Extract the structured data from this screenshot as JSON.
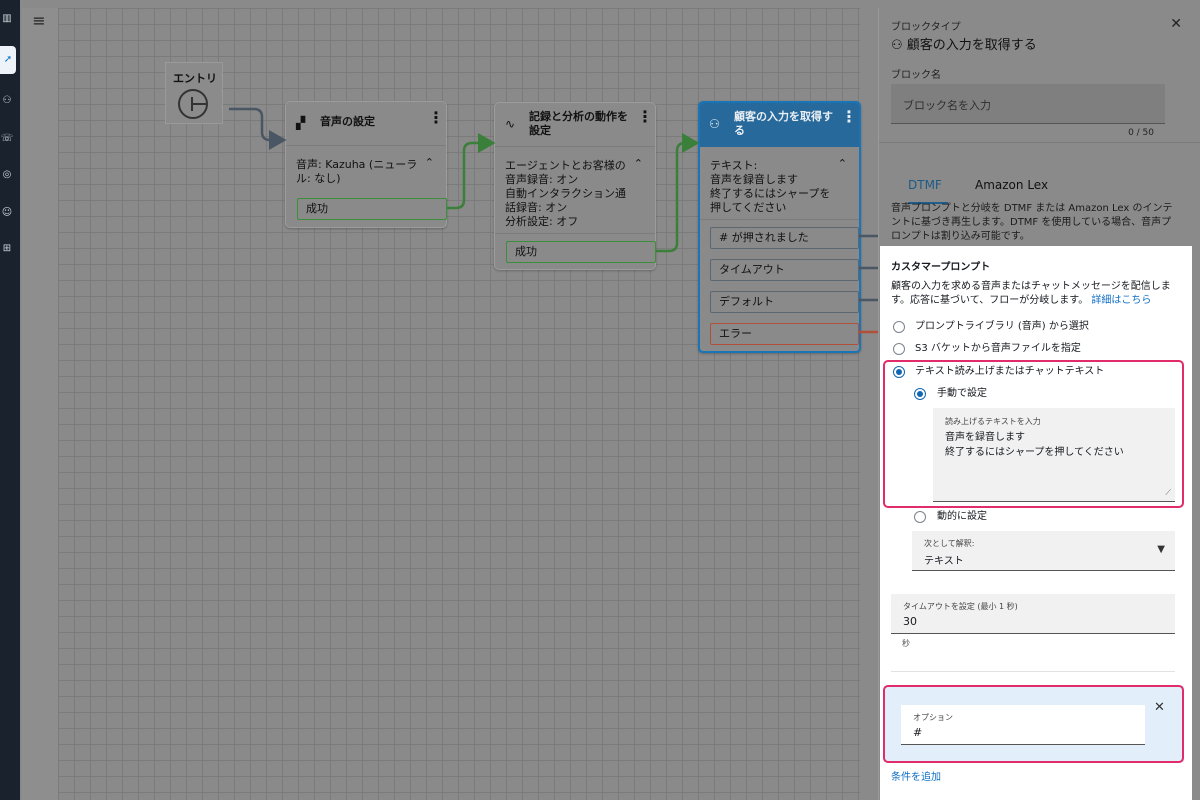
{
  "nav": {
    "icons": [
      "bar-chart-icon",
      "routing-icon",
      "users-icon",
      "phone-flow-icon",
      "headset-icon",
      "person-icon",
      "hierarchy-icon"
    ]
  },
  "canvas": {
    "menu_glyph": "≡",
    "entry": {
      "title": "エントリ"
    },
    "blocks": [
      {
        "title": "音声の設定",
        "body": "音声: Kazuha (ニューラル: なし)",
        "ports": [
          "成功"
        ]
      },
      {
        "title": "記録と分析の動作を設定",
        "body": "エージェントとお客様の音声録音: オン\n自動インタラクション通話録音: オン\n分析設定: オフ",
        "ports": [
          "成功"
        ]
      },
      {
        "title": "顧客の入力を取得する",
        "body": "テキスト:\n音声を録音します\n終了するにはシャープを押してください",
        "ports": [
          "# が押されました",
          "タイムアウト",
          "デフォルト",
          "エラー"
        ]
      }
    ]
  },
  "panel": {
    "block_type_label": "ブロックタイプ",
    "block_type": "顧客の入力を取得する",
    "block_name_label": "ブロック名",
    "block_name_placeholder": "ブロック名を入力",
    "counter": "0 / 50",
    "tabs": [
      "DTMF",
      "Amazon Lex"
    ],
    "description": "音声プロンプトと分岐を DTMF または Amazon Lex のインテントに基づき再生します。DTMF を使用している場合、音声プロンプトは割り込み可能です。",
    "prompt": {
      "heading": "カスタマープロンプト",
      "description": "顧客の入力を求める音声またはチャットメッセージを配信します。応答に基づいて、フローが分岐します。",
      "link": "詳細はこちら",
      "options": [
        "プロンプトライブラリ (音声) から選択",
        "S3 バケットから音声ファイルを指定",
        "テキスト読み上げまたはチャットテキスト"
      ],
      "sub_options": [
        "手動で設定",
        "動的に設定"
      ],
      "text_label": "読み上げるテキストを入力",
      "text_value": "音声を録音します\n終了するにはシャープを押してください",
      "interpret_label": "次として解釈:",
      "interpret_value": "テキスト"
    },
    "timeout": {
      "label": "タイムアウトを設定 (最小 1 秒)",
      "value": "30",
      "unit": "秒"
    },
    "option": {
      "label": "オプション",
      "value": "#"
    },
    "add_condition": "条件を追加"
  },
  "colors": {
    "accent_blue": "#1167b1",
    "highlight_pink": "#e22b6a",
    "success_green": "#3b8e3a",
    "error_red": "#b0503a",
    "selected_header": "#27699a"
  }
}
